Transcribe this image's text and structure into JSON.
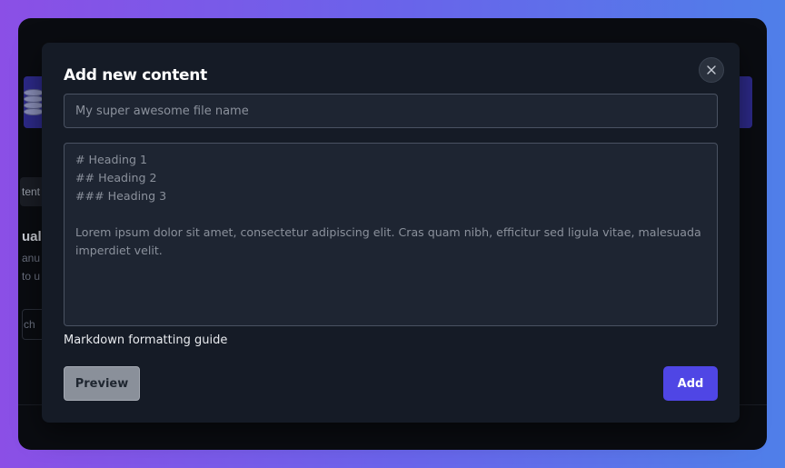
{
  "modal": {
    "title": "Add new content",
    "name_input": {
      "value": "",
      "placeholder": "My super awesome file name"
    },
    "content_textarea": {
      "value": "",
      "placeholder": "# Heading 1\n## Heading 2\n### Heading 3\n\nLorem ipsum dolor sit amet, consectetur adipiscing elit. Cras quam nibh, efficitur sed ligula vitae, malesuada imperdiet velit."
    },
    "guide_link_label": "Markdown formatting guide",
    "preview_label": "Preview",
    "add_label": "Add",
    "close_icon": "close-icon"
  },
  "background": {
    "tab_fragment": "tent",
    "heading_fragment": "ual",
    "line1_fragment": "anu",
    "line2_fragment": "to u",
    "input_fragment": "ch"
  },
  "colors": {
    "accent": "#4f46e5",
    "modal_bg": "#151b26",
    "input_bg": "#1e2532",
    "banner": "#2d2a8a"
  }
}
